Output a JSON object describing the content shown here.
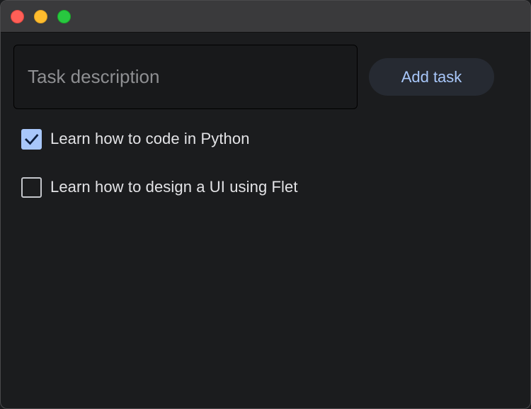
{
  "window": {
    "controls": [
      "close",
      "minimize",
      "maximize"
    ]
  },
  "input": {
    "placeholder": "Task description",
    "value": ""
  },
  "add_button": {
    "label": "Add task"
  },
  "tasks": [
    {
      "label": "Learn how to code in Python",
      "checked": true
    },
    {
      "label": "Learn how to design a UI using Flet",
      "checked": false
    }
  ],
  "colors": {
    "accent": "#a8c7fa",
    "background": "#1b1c1e",
    "titlebar": "#3a3a3c",
    "close": "#ff5f57",
    "minimize": "#febc2e",
    "maximize": "#28c840"
  },
  "icons": {
    "checked": "checkmark-icon"
  }
}
